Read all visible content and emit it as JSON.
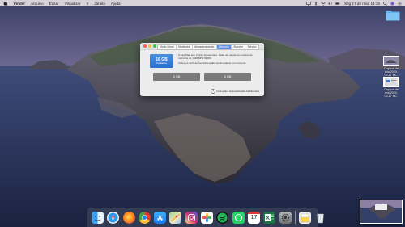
{
  "menubar": {
    "app": "Finder",
    "items": [
      "Arquivo",
      "Editar",
      "Visualizar",
      "Ir",
      "Janela",
      "Ajuda"
    ],
    "clock": "Seg 17 de mar. 14:35"
  },
  "desktop": {
    "icons": [
      {
        "name": "folder",
        "label": ""
      },
      {
        "name": "screenshot-1",
        "label": "Captura de\ntela 2020-\n03-17 às..."
      },
      {
        "name": "screenshot-2",
        "label": "Captura de\ntela 2020-\n03-17 às..."
      }
    ]
  },
  "window": {
    "tabs": [
      "Visão Geral",
      "Monitores",
      "Armazenamento",
      "Memória",
      "Suporte",
      "Serviço"
    ],
    "active_tab": "Memória",
    "memory_size": "16 GB",
    "memory_label": "Instalados",
    "info_line1": "O seu Mac tem 2 slots de memória. Cada um aceita um módulo de memória de 1600 MHz DDR3.",
    "info_line2": "Todos os slots de memória estão sendo usados no momento.",
    "slots": [
      "8 GB",
      "8 GB"
    ],
    "help_link": "Instruções de Atualização da Memória"
  },
  "dock": {
    "apps": [
      "finder",
      "safari",
      "firefox",
      "chrome",
      "app-store",
      "maps",
      "instagram",
      "photos",
      "spotify",
      "whatsapp",
      "calendar",
      "excel",
      "system-preferences",
      "preview",
      "trash"
    ],
    "calendar_day": "17"
  },
  "colors": {
    "accent": "#5b8ee6",
    "memory_card": "#3a80d8",
    "slot": "#7a7a7a"
  }
}
